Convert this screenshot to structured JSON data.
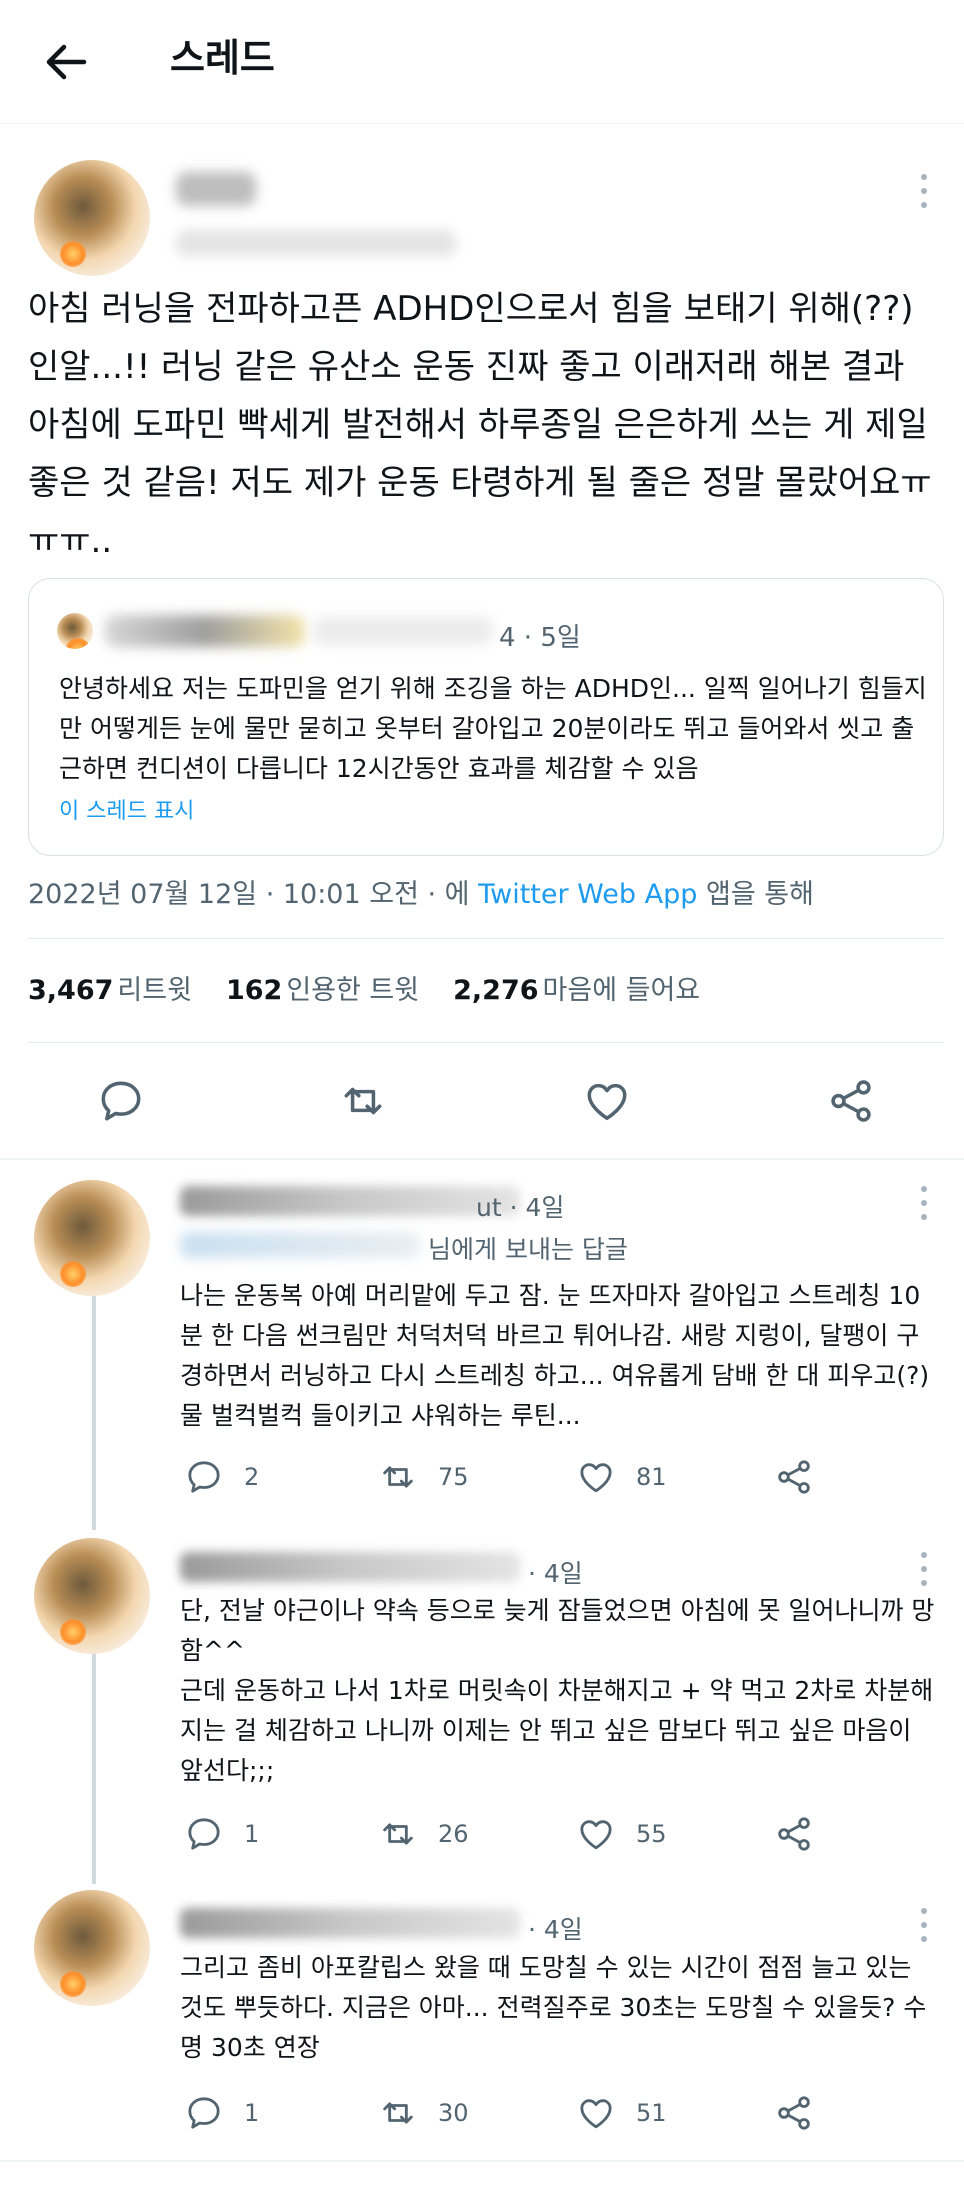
{
  "header": {
    "title": "스레드",
    "back_icon": "arrow-left-icon"
  },
  "main_tweet": {
    "text": "아침 러닝을 전파하고픈 ADHD인으로서 힘을 보태기 위해(??) 인알...!! 러닝 같은 유산소 운동 진짜 좋고 이래저래 해본 결과 아침에 도파민 빡세게 발전해서 하루종일 은은하게 쓰는 게 제일 좋은 것 같음! 저도 제가 운동 타령하게 될 줄은 정말 몰랐어요ㅠㅠㅠ..",
    "quote": {
      "date": "4 · 5일",
      "text": "안녕하세요 저는 도파민을 얻기 위해 조깅을 하는 ADHD인... 일찍 일어나기 힘들지만 어떻게든 눈에 물만 묻히고 옷부터 갈아입고 20분이라도 뛰고 들어와서 씻고 출근하면 컨디션이 다릅니다 12시간동안 효과를 체감할 수 있음",
      "show_thread": "이 스레드 표시"
    },
    "timestamp_prefix": "2022년 07월 12일 · 10:01 오전 · 에 ",
    "source": "Twitter Web App",
    "timestamp_suffix": " 앱을 통해",
    "stats": {
      "retweets": "3,467",
      "retweets_label": "리트윗",
      "quotes": "162",
      "quotes_label": "인용한 트윗",
      "likes": "2,276",
      "likes_label": "마음에 들어요"
    }
  },
  "replies": [
    {
      "time": "ut · 4일",
      "replying_to": "님에게 보내는 답글",
      "text": "나는 운동복 아예 머리맡에 두고 잠. 눈 뜨자마자 갈아입고 스트레칭 10분 한 다음 썬크림만 처덕처덕 바르고 튀어나감. 새랑 지렁이, 달팽이 구경하면서 러닝하고 다시 스트레칭 하고... 여유롭게 담배 한 대 피우고(?) 물 벌컥벌컥 들이키고 샤워하는 루틴...",
      "replies": "2",
      "retweets": "75",
      "likes": "81"
    },
    {
      "time": "· 4일",
      "text": "단, 전날 야근이나 약속 등으로 늦게 잠들었으면 아침에 못 일어나니까 망함^^\n근데 운동하고 나서 1차로 머릿속이 차분해지고 + 약 먹고 2차로 차분해지는 걸 체감하고 나니까 이제는 안 뛰고 싶은 맘보다 뛰고 싶은 마음이 앞선다;;;",
      "replies": "1",
      "retweets": "26",
      "likes": "55"
    },
    {
      "time": "· 4일",
      "text": "그리고 좀비 아포칼립스 왔을 때 도망칠 수 있는 시간이 점점 늘고 있는 것도 뿌듯하다. 지금은 아마... 전력질주로 30초는 도망칠 수 있을듯? 수명 30초 연장",
      "replies": "1",
      "retweets": "30",
      "likes": "51"
    }
  ],
  "colors": {
    "accent": "#1d9bf0",
    "secondary_text": "#536471",
    "icon": "#536471"
  }
}
